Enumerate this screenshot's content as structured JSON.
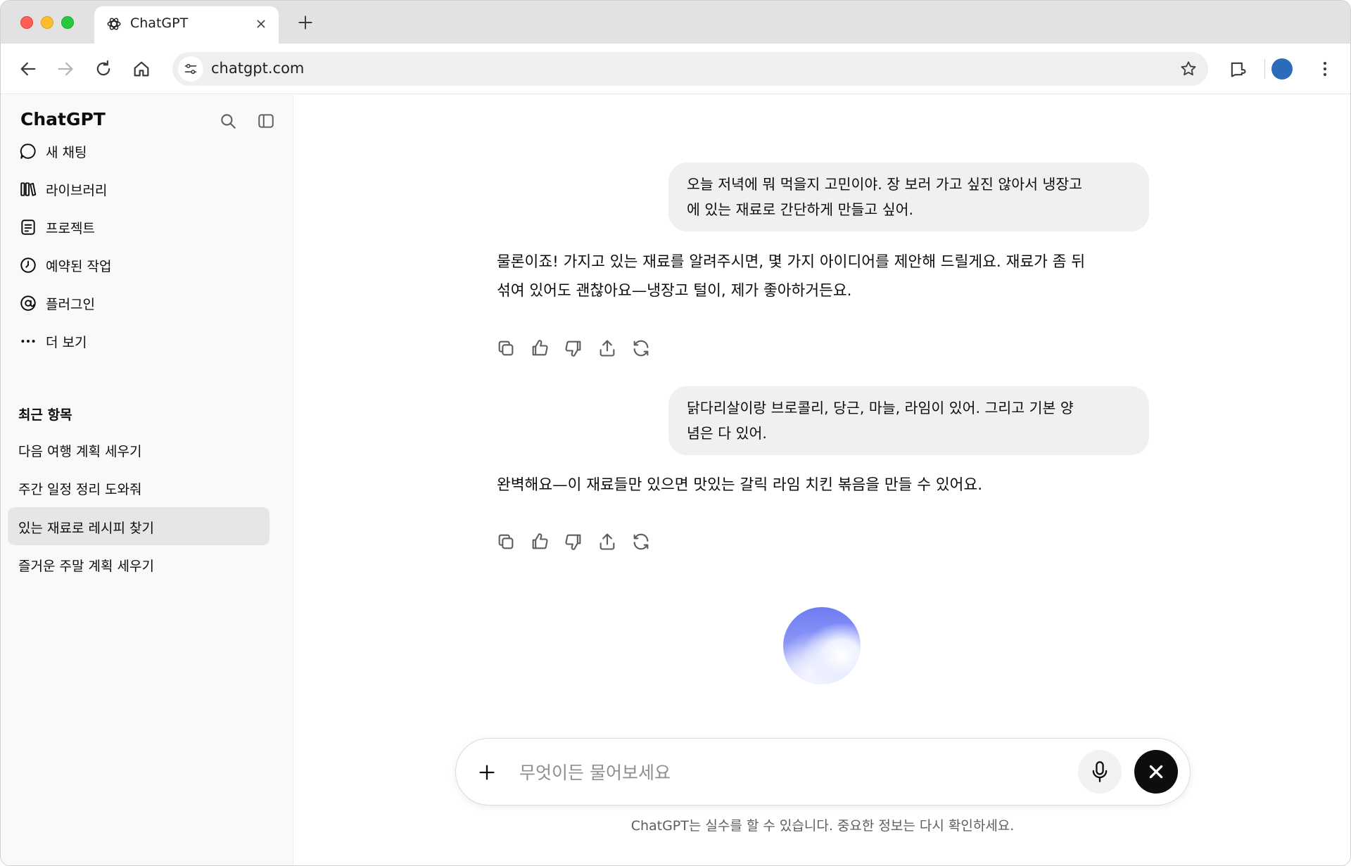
{
  "browser": {
    "tab_title": "ChatGPT",
    "url": "chatgpt.com",
    "icons": [
      "close-icon",
      "plus-icon",
      "back-icon",
      "forward-icon",
      "reload-icon",
      "home-icon",
      "tune-icon",
      "star-icon",
      "extension-icon",
      "profile-avatar",
      "kebab-menu-icon"
    ],
    "colors": {
      "tabstrip": "#e2e2e2",
      "omnibox": "#efefef",
      "profile": "#2b6cb8"
    }
  },
  "sidebar": {
    "brand": "ChatGPT",
    "nav": [
      {
        "label": "새 채팅",
        "icon": "chat-bubble-icon"
      },
      {
        "label": "라이브러리",
        "icon": "library-icon"
      },
      {
        "label": "프로젝트",
        "icon": "project-icon"
      },
      {
        "label": "예약된 작업",
        "icon": "clock-icon"
      },
      {
        "label": "플러그인",
        "icon": "plugin-icon"
      },
      {
        "label": "더 보기",
        "icon": "more-icon"
      }
    ],
    "recent_title": "최근 항목",
    "recent": [
      {
        "label": "다음 여행 계획 세우기",
        "active": false
      },
      {
        "label": "주간 일정 정리 도와줘",
        "active": false
      },
      {
        "label": "있는 재료로 레시피 찾기",
        "active": true
      },
      {
        "label": "즐거운 주말 계획 세우기",
        "active": false
      }
    ]
  },
  "chat": {
    "messages": [
      {
        "role": "user",
        "lines": [
          "오늘 저녁에 뭐 먹을지 고민이야. 장 보러 가고 싶진 않아서 냉장고",
          "에 있는 재료로 간단하게 만들고 싶어."
        ]
      },
      {
        "role": "assistant",
        "lines": [
          "물론이죠! 가지고 있는 재료를 알려주시면, 몇 가지 아이디어를 제안해 드릴게요. 재료가 좀 뒤",
          "섞여 있어도 괜찮아요—냉장고 털이, 제가 좋아하거든요."
        ]
      },
      {
        "role": "user",
        "lines": [
          "닭다리살이랑 브로콜리, 당근, 마늘, 라임이 있어. 그리고 기본 양",
          "념은 다 있어."
        ]
      },
      {
        "role": "assistant",
        "lines": [
          "완벽해요—이 재료들만 있으면 맛있는 갈릭 라임 치킨 볶음을 만들 수 있어요."
        ]
      }
    ],
    "message_actions": [
      "copy-icon",
      "thumbs-up-icon",
      "thumbs-down-icon",
      "share-icon",
      "regenerate-icon"
    ],
    "composer": {
      "placeholder": "무엇이든 물어보세요",
      "value": "",
      "icons": [
        "plus-icon",
        "mic-icon",
        "close-icon"
      ]
    },
    "disclaimer": "ChatGPT는 실수를 할 수 있습니다. 중요한 정보는 다시 확인하세요."
  }
}
